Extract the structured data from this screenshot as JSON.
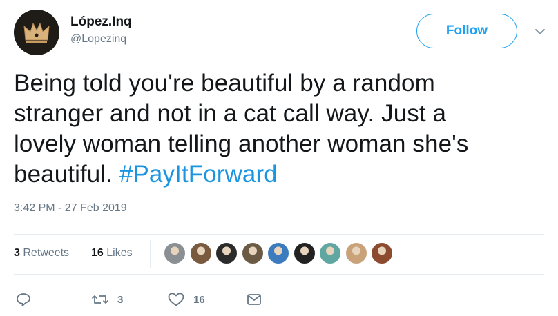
{
  "user": {
    "display_name": "López.Inq",
    "handle": "@Lopezinq",
    "avatar_icon": "crown-icon"
  },
  "follow_label": "Follow",
  "tweet": {
    "lines": [
      "Being told you're beautiful by a random",
      "stranger and not in a cat call way. Just a",
      "lovely woman telling another woman she's",
      "beautiful."
    ],
    "hashtag": "#PayItForward",
    "timestamp": "3:42 PM - 27 Feb 2019"
  },
  "stats": {
    "retweets_count": "3",
    "retweets_label": "Retweets",
    "likes_count": "16",
    "likes_label": "Likes"
  },
  "liker_avatars": [
    {
      "color": "#8a8f94"
    },
    {
      "color": "#7a5a3e"
    },
    {
      "color": "#2b2b2b"
    },
    {
      "color": "#6b5b45"
    },
    {
      "color": "#3d7bbf"
    },
    {
      "color": "#222222"
    },
    {
      "color": "#5fa7a0"
    },
    {
      "color": "#c9a27a"
    },
    {
      "color": "#8c4a2f"
    }
  ],
  "actions": {
    "reply_icon": "reply-icon",
    "retweet_icon": "retweet-icon",
    "retweet_count": "3",
    "like_icon": "heart-icon",
    "like_count": "16",
    "dm_icon": "envelope-icon"
  },
  "colors": {
    "accent": "#1da1f2",
    "hashtag": "#1b95e0",
    "secondary_text": "#657786",
    "primary_text": "#14171a",
    "divider": "#e6ecf0"
  }
}
